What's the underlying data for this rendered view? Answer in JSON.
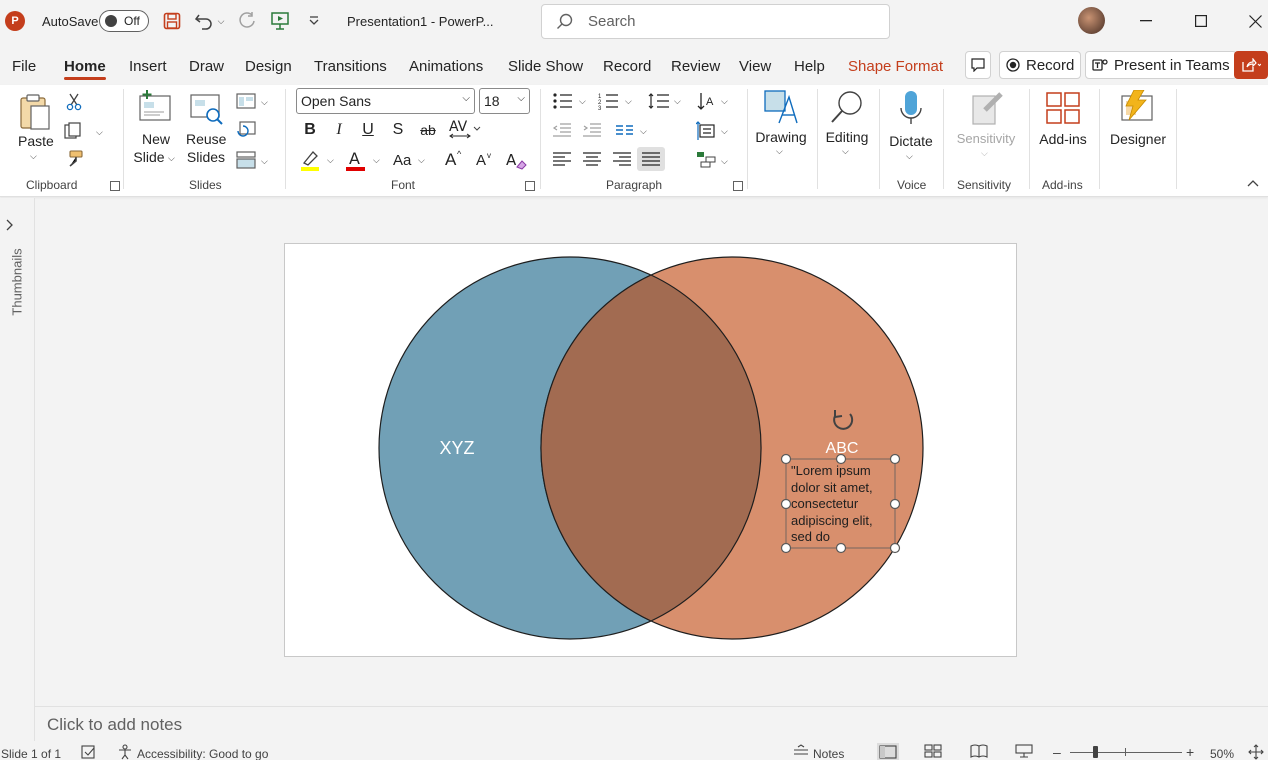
{
  "titlebar": {
    "app_letter": "P",
    "autosave_label": "AutoSave",
    "autosave_state": "Off",
    "document_title": "Presentation1  -  PowerP...",
    "search_placeholder": "Search"
  },
  "tabs": [
    "File",
    "Home",
    "Insert",
    "Draw",
    "Design",
    "Transitions",
    "Animations",
    "Slide Show",
    "Record",
    "Review",
    "View",
    "Help",
    "Shape Format"
  ],
  "tab_active": "Home",
  "top_buttons": {
    "record": "Record",
    "present": "Present in Teams"
  },
  "ribbon": {
    "clipboard": {
      "paste": "Paste",
      "label": "Clipboard"
    },
    "slides": {
      "new_slide_1": "New",
      "new_slide_2": "Slide",
      "reuse_1": "Reuse",
      "reuse_2": "Slides",
      "label": "Slides"
    },
    "font": {
      "family": "Open Sans",
      "size": "18",
      "label": "Font",
      "bold": "B",
      "italic": "I",
      "underline": "U",
      "shadow": "S",
      "strike": "ab",
      "case": "Aa",
      "grow": "A",
      "shrink": "A"
    },
    "paragraph": {
      "label": "Paragraph"
    },
    "drawing": {
      "label": "Drawing"
    },
    "editing": {
      "label": "Editing"
    },
    "voice": {
      "dictate": "Dictate",
      "label": "Voice"
    },
    "sensitivity": {
      "button": "Sensitivity",
      "label": "Sensitivity"
    },
    "addins": {
      "button": "Add-ins",
      "label": "Add-ins"
    },
    "designer": {
      "button": "Designer"
    }
  },
  "colors": {
    "accent": "#c43e1c",
    "circle_left": "#71a0b6",
    "circle_right": "#d88f6d",
    "overlap": "#a26b51",
    "highlight": "#ffff00",
    "font_color": "#e00000"
  },
  "thumbnails_label": "Thumbnails",
  "slide": {
    "left_label": "XYZ",
    "right_label": "ABC",
    "textbox_lines": [
      "\"Lorem   ipsum",
      "dolor  sit  amet,",
      "consectetur",
      "adipiscing   elit,",
      "sed do"
    ]
  },
  "notes_placeholder": "Click to add notes",
  "statusbar": {
    "slide_count": "Slide 1 of 1",
    "accessibility": "Accessibility: Good to go",
    "notes": "Notes",
    "zoom": "50%"
  }
}
